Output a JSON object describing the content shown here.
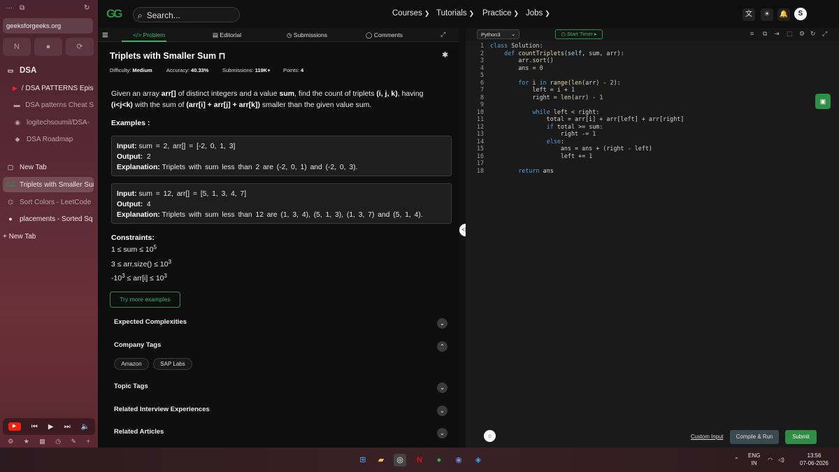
{
  "browser": {
    "url": "geeksforgeeks.org",
    "top_icons": [
      "menu-dots",
      "window",
      "refresh"
    ],
    "pinned": [
      "notion-icon",
      "pin-icon",
      "extension-icon"
    ],
    "folder": "DSA",
    "folder_items": [
      "/ DSA PATTERNS Episo",
      "DSA patterns Cheat S",
      "logitechsoumil/DSA-",
      "DSA Roadmap"
    ],
    "tabs": [
      "New Tab",
      "Triplets with Smaller Sur",
      "Sort Colors - LeetCode",
      "placements - Sorted Sq"
    ],
    "new_tab": "+ New Tab",
    "active_tab_index": 1
  },
  "gfg": {
    "logo": "GG",
    "search_placeholder": "Search...",
    "nav": [
      "Courses",
      "Tutorials",
      "Practice",
      "Jobs"
    ],
    "avatar_letter": "S"
  },
  "tabs": {
    "problem": "Problem",
    "editorial": "Editorial",
    "submissions": "Submissions",
    "comments": "Comments"
  },
  "problem": {
    "title": "Triplets with Smaller Sum",
    "difficulty_label": "Difficulty:",
    "difficulty": "Medium",
    "accuracy_label": "Accuracy:",
    "accuracy": "40.33%",
    "submissions_label": "Submissions:",
    "submissions": "119K+",
    "points_label": "Points:",
    "points": "4",
    "desc": {
      "p1": "Given an array ",
      "b1": "arr[]",
      "p2": " of distinct integers and a value ",
      "b2": "sum",
      "p3": ", find the count of triplets ",
      "b3": "(i, j, k)",
      "p4": ", having ",
      "b4": "(i<j<k)",
      "p5": " with the sum of ",
      "b5": "(arr[i] + arr[j] + arr[k])",
      "p6": " smaller than the given value sum."
    },
    "examples_heading": "Examples :",
    "examples": [
      {
        "input_label": "Input:",
        "input": "sum = 2, arr[] = [-2, 0, 1, 3]",
        "output_label": "Output:",
        "output": "2",
        "expl_label": "Explanation:",
        "expl": "Triplets with sum less than 2 are (-2, 0, 1) and (-2, 0, 3)."
      },
      {
        "input_label": "Input:",
        "input": "sum = 12, arr[] = [5, 1, 3, 4, 7]",
        "output_label": "Output:",
        "output": "4",
        "expl_label": "Explanation:",
        "expl": "Triplets with sum less than 12 are (1, 3, 4), (5, 1, 3), (1, 3, 7) and (5, 1, 4)."
      }
    ],
    "constraints_heading": "Constraints:",
    "constraints": [
      {
        "pre": "1 ≤ sum ≤ 10",
        "sup": "5",
        "post": ""
      },
      {
        "pre": "3 ≤ arr.size() ≤ 10",
        "sup": "3",
        "post": ""
      },
      {
        "pre": "-10",
        "sup": "3",
        "post": " ≤ arr[i] ≤ 10",
        "sup2": "3"
      }
    ],
    "try_more": "Try more examples",
    "sections": [
      "Expected Complexities",
      "Company Tags",
      "Topic Tags",
      "Related Interview Experiences",
      "Related Articles"
    ],
    "company_tags": [
      "Amazon",
      "SAP Labs"
    ]
  },
  "editor": {
    "language": "Python3",
    "timer": "Start Timer",
    "custom_input": "Custom Input",
    "compile_run": "Compile & Run",
    "submit": "Submit",
    "code_lines": [
      "class Solution:",
      "    def countTriplets(self, sum, arr):",
      "        arr.sort()",
      "        ans = 0",
      "",
      "        for i in range(len(arr) - 2):",
      "            left = i + 1",
      "            right = len(arr) - 1",
      "",
      "            while left < right:",
      "                total = arr[i] + arr[left] + arr[right]",
      "                if total >= sum:",
      "                    right -= 1",
      "                else:",
      "                    ans = ans + (right - left)",
      "                    left += 1",
      "",
      "        return ans"
    ]
  },
  "taskbar": {
    "lang": "ENG",
    "region": "IN",
    "time": "13:56",
    "date": "07-06-2026"
  }
}
